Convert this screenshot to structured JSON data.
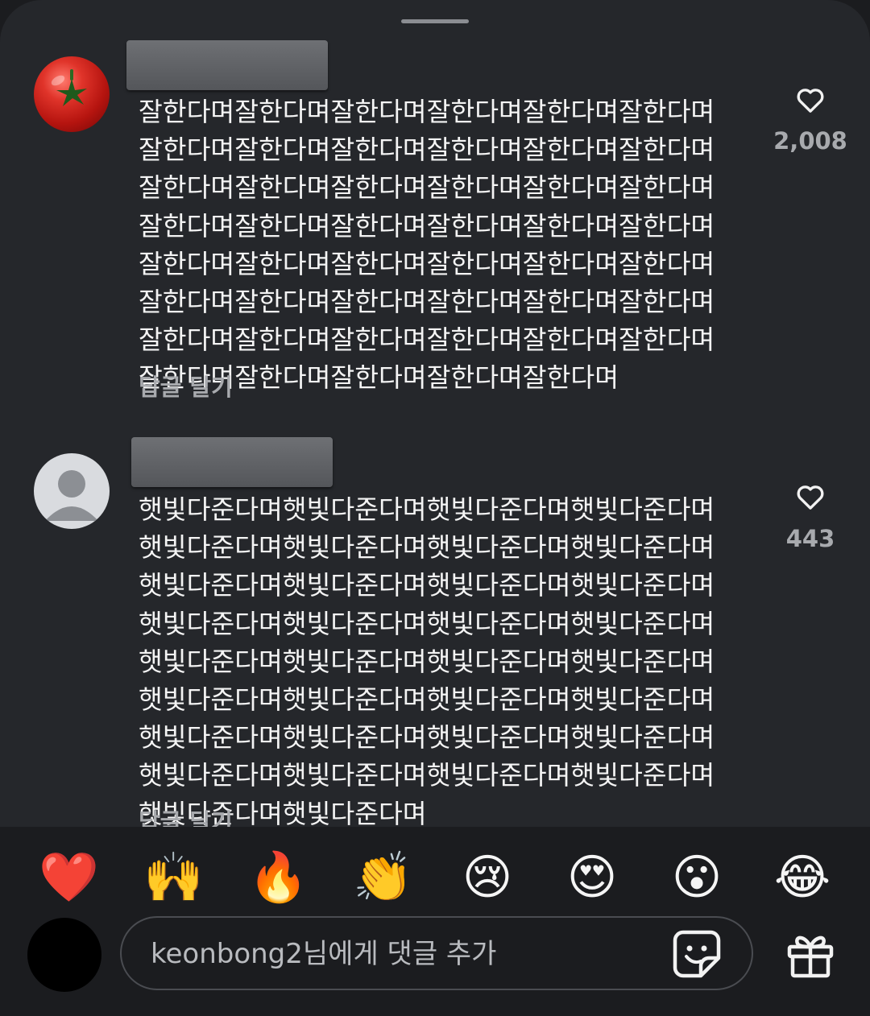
{
  "comments": [
    {
      "text": "잘한다며잘한다며잘한다며잘한다며잘한다며잘한다며잘한다며잘한다며잘한다며잘한다며잘한다며잘한다며잘한다며잘한다며잘한다며잘한다며잘한다며잘한다며잘한다며잘한다며잘한다며잘한다며잘한다며잘한다며잘한다며잘한다며잘한다며잘한다며잘한다며잘한다며잘한다며잘한다며잘한다며잘한다며잘한다며잘한다며잘한다며잘한다며잘한다며잘한다며잘한다며잘한다며잘한다며잘한다며잘한다며잘한다며잘한다며",
      "reply_label": "답글 달기",
      "like_count": "2,008"
    },
    {
      "text": "햇빛다준다며햇빛다준다며햇빛다준다며햇빛다준다며햇빛다준다며햇빛다준다며햇빛다준다며햇빛다준다며햇빛다준다며햇빛다준다며햇빛다준다며햇빛다준다며햇빛다준다며햇빛다준다며햇빛다준다며햇빛다준다며햇빛다준다며햇빛다준다며햇빛다준다며햇빛다준다며햇빛다준다며햇빛다준다며햇빛다준다며햇빛다준다며햇빛다준다며햇빛다준다며햇빛다준다며햇빛다준다며햇빛다준다며햇빛다준다며햇빛다준다며햇빛다준다며햇빛다준다며햇빛다준다며",
      "reply_label": "답글 달기",
      "like_count": "443"
    }
  ],
  "reactions": [
    "❤️",
    "🙌",
    "🔥",
    "👏",
    "😢",
    "😍",
    "😮",
    "😂"
  ],
  "composer": {
    "placeholder": "keonbong2님에게 댓글 추가"
  },
  "icons": {
    "like": "heart-outline-icon",
    "sticker": "sticker-icon",
    "gift": "gift-icon"
  },
  "colors": {
    "background": "#25272b",
    "bottom_bar": "#1b1c1f",
    "secondary_text": "#a8aaae"
  }
}
